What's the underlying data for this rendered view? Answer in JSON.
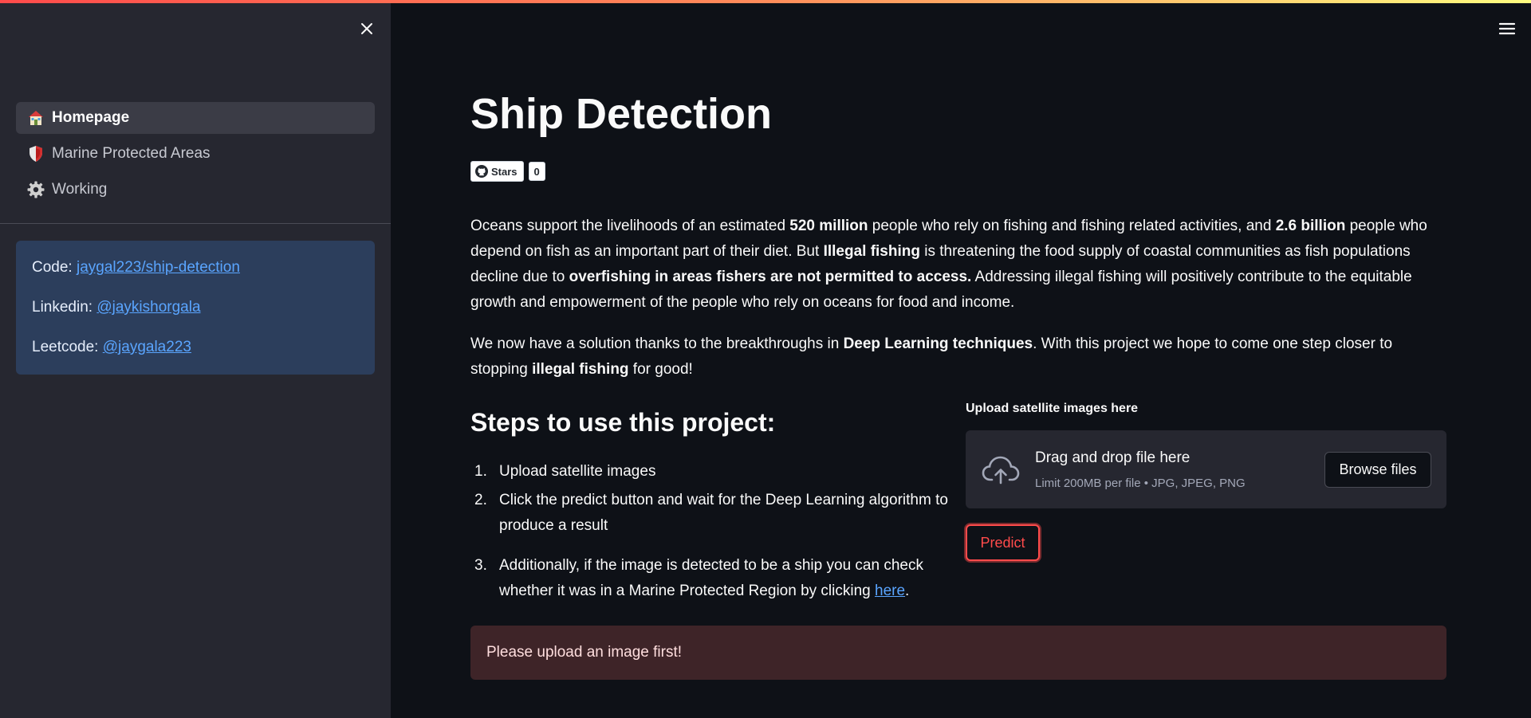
{
  "sidebar": {
    "nav": [
      {
        "label": "Homepage",
        "icon": "house-icon",
        "active": true
      },
      {
        "label": "Marine Protected Areas",
        "icon": "shield-icon",
        "active": false
      },
      {
        "label": "Working",
        "icon": "gear-icon",
        "active": false
      }
    ],
    "links": {
      "code_label": "Code:",
      "code_link": "jaygal223/ship-detection",
      "linkedin_label": "Linkedin:",
      "linkedin_link": "@jaykishorgala",
      "leetcode_label": "Leetcode:",
      "leetcode_link": "@jaygala223"
    }
  },
  "main": {
    "title": "Ship Detection",
    "badge": {
      "label": "Stars",
      "count": "0"
    },
    "para1": {
      "t1": "Oceans support the livelihoods of an estimated ",
      "b1": "520 million",
      "t2": " people who rely on fishing and fishing related activities, and ",
      "b2": "2.6 billion",
      "t3": " people who depend on fish as an important part of their diet. But ",
      "b3": "Illegal fishing",
      "t4": " is threatening the food supply of coastal communities as fish populations decline due to ",
      "b4": "overfishing in areas fishers are not permitted to access.",
      "t5": " Addressing illegal fishing will positively contribute to the equitable growth and empowerment of the people who rely on oceans for food and income."
    },
    "para2": {
      "t1": "We now have a solution thanks to the breakthroughs in ",
      "b1": "Deep Learning techniques",
      "t2": ". With this project we hope to come one step closer to stopping ",
      "b2": "illegal fishing",
      "t3": " for good!"
    },
    "steps_title": "Steps to use this project:",
    "steps": [
      {
        "num": "1.",
        "text": "Upload satellite images"
      },
      {
        "num": "2.",
        "text": "Click the predict button and wait for the Deep Learning algorithm to produce a result"
      },
      {
        "num": "3.",
        "text": "Additionally, if the image is detected to be a ship you can check whether it was in a Marine Protected Region by clicking ",
        "link": "here",
        "after": "."
      }
    ],
    "uploader": {
      "label": "Upload satellite images here",
      "title": "Drag and drop file here",
      "subtitle": "Limit 200MB per file • JPG, JPEG, PNG",
      "browse": "Browse files"
    },
    "predict": "Predict",
    "alert": "Please upload an image first!"
  },
  "colors": {
    "background": "#0e1117",
    "sidebar": "#262730",
    "accent": "#ff4b4b",
    "link": "#5aa5ff",
    "info_box": "#2c3e5c",
    "alert_bg": "#3e2428"
  }
}
